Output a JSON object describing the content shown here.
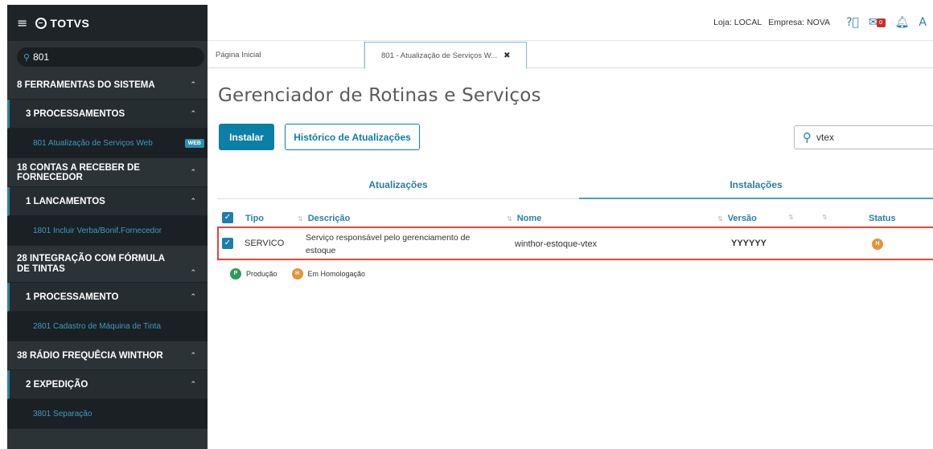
{
  "sidebar": {
    "logo": "TOTVS",
    "search_value": "801",
    "items": [
      {
        "kind": "group",
        "label": "8  FERRAMENTAS DO SISTEMA",
        "h": 36
      },
      {
        "kind": "sub",
        "label": "3  PROCESSAMENTOS",
        "h": 36
      },
      {
        "kind": "leaf",
        "label": "801  Atualização de Serviços Web",
        "badge": "WEB",
        "h": 37
      },
      {
        "kind": "group",
        "label": "18  CONTAS A RECEBER DE FORNECEDOR",
        "h": 36
      },
      {
        "kind": "sub",
        "label": "1  LANCAMENTOS",
        "h": 36
      },
      {
        "kind": "leaf",
        "label": "1801  Incluir Verba/Bonif.Fornecedor",
        "h": 37
      },
      {
        "kind": "group",
        "label": "28  INTEGRAÇÃO COM FÓRMULA DE TINTAS",
        "h": 46
      },
      {
        "kind": "sub",
        "label": "1  PROCESSAMENTO",
        "h": 36
      },
      {
        "kind": "leaf",
        "label": "2801  Cadastro de Máquina de Tinta",
        "h": 37
      },
      {
        "kind": "group",
        "label": "38  RÁDIO FREQUÊCIA WINTHOR",
        "h": 36
      },
      {
        "kind": "sub",
        "label": "2  EXPEDIÇÃO",
        "h": 36
      },
      {
        "kind": "leaf",
        "label": "3801  Separação",
        "h": 37
      }
    ]
  },
  "topbar": {
    "loja": "Loja: LOCAL",
    "empresa": "Empresa: NOVA",
    "mail_count": "0"
  },
  "tabs": [
    {
      "label": "Página Inicial"
    },
    {
      "label": "801 - Atualização de Serviços W..."
    }
  ],
  "page": {
    "title": "Gerenciador de Rotinas e Serviços",
    "install_button": "Instalar",
    "history_button": "Histórico de Atualizações",
    "search_value": "vtex"
  },
  "sub_tabs": {
    "atualizacoes": "Atualizações",
    "instalacoes": "Instalações"
  },
  "table": {
    "headers": {
      "tipo": "Tipo",
      "descricao": "Descrição",
      "nome": "Nome",
      "versao": "Versão",
      "status": "Status"
    },
    "rows": [
      {
        "tipo": "SERVICO",
        "descricao_line1": "Serviço responsável pelo gerenciamento de",
        "descricao_line2": "estoque",
        "nome": "winthor-estoque-vtex",
        "versao": "YYYYYY",
        "status_letter": "H"
      }
    ]
  },
  "legend": {
    "producao_letter": "P",
    "producao_label": "Produção",
    "homologacao_letter": "H",
    "homologacao_label": "Em Homologação"
  },
  "colors": {
    "sidebar_bg": "#2b3337",
    "accent": "#0c7fa6",
    "producao": "#2e9a57",
    "homologacao": "#e6923a",
    "row_highlight": "#e2453c"
  }
}
